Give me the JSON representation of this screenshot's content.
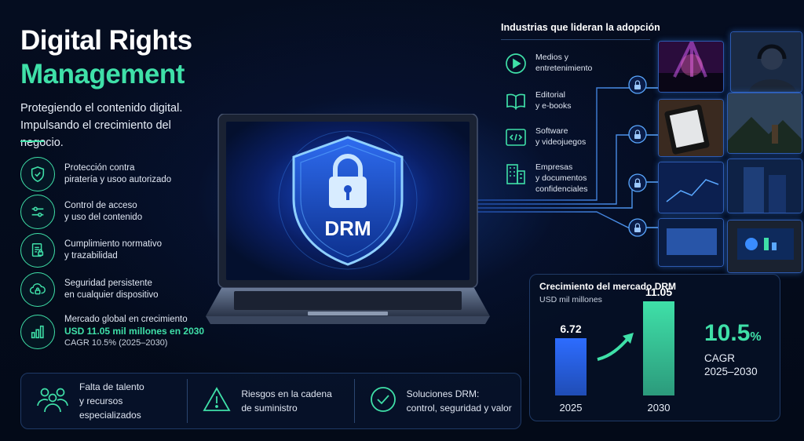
{
  "header": {
    "title_line1": "Digital Rights",
    "title_line2": "Management",
    "tagline_line1": "Protegiendo el contenido digital.",
    "tagline_line2": "Impulsando el crecimiento del negocio."
  },
  "features": [
    {
      "icon": "shield-check-icon",
      "line1": "Protección contra",
      "line2": "piratería y usoo autorizado"
    },
    {
      "icon": "sliders-icon",
      "line1": "Control de acceso",
      "line2": "y uso del contenido"
    },
    {
      "icon": "compliance-doc-icon",
      "line1": "Cumplimiento normativo",
      "line2": "y trazabilidad"
    },
    {
      "icon": "cloud-lock-icon",
      "line1": "Seguridad persistente",
      "line2": "en cualquier dispositivo"
    },
    {
      "icon": "bar-chart-icon",
      "line1": "Mercado global en crecimiento",
      "highlight": "USD 11.05 mil millones en 2030",
      "line3": "CAGR 10.5%  (2025–2030)"
    }
  ],
  "bottom_bar": [
    {
      "icon": "people-icon",
      "line1": "Falta de talento",
      "line2": "y recursos especializados"
    },
    {
      "icon": "warning-icon",
      "line1": "Riesgos en la cadena",
      "line2": "de suministro"
    },
    {
      "icon": "check-circle-icon",
      "line1": "Soluciones DRM:",
      "line2": "control, seguridad y valor"
    }
  ],
  "laptop": {
    "screen_label": "DRM"
  },
  "industries": {
    "title": "Industrias que lideran la adopción",
    "items": [
      {
        "icon": "play-icon",
        "line1": "Medios y",
        "line2": "entretenimiento",
        "line3": ""
      },
      {
        "icon": "book-icon",
        "line1": "Editorial",
        "line2": "y e-books",
        "line3": ""
      },
      {
        "icon": "code-icon",
        "line1": "Software",
        "line2": "y videojuegos",
        "line3": ""
      },
      {
        "icon": "building-icon",
        "line1": "Empresas",
        "line2": "y documentos",
        "line3": "confidenciales"
      }
    ]
  },
  "colors": {
    "accent": "#3fe0a8",
    "blue": "#2d6cff",
    "background": "#030a18"
  },
  "market": {
    "title": "Crecimiento del mercado DRM",
    "subtitle": "USD mil millones",
    "cagr_value": "10.5",
    "cagr_unit": "%",
    "cagr_label": "CAGR",
    "cagr_period": "2025–2030"
  },
  "chart_data": {
    "type": "bar",
    "categories": [
      "2025",
      "2030"
    ],
    "values": [
      6.72,
      11.05
    ],
    "value_labels": [
      "6.72",
      "11.05"
    ],
    "title": "Crecimiento del mercado DRM",
    "ylabel": "USD mil millones",
    "ylim": [
      0,
      12
    ]
  }
}
